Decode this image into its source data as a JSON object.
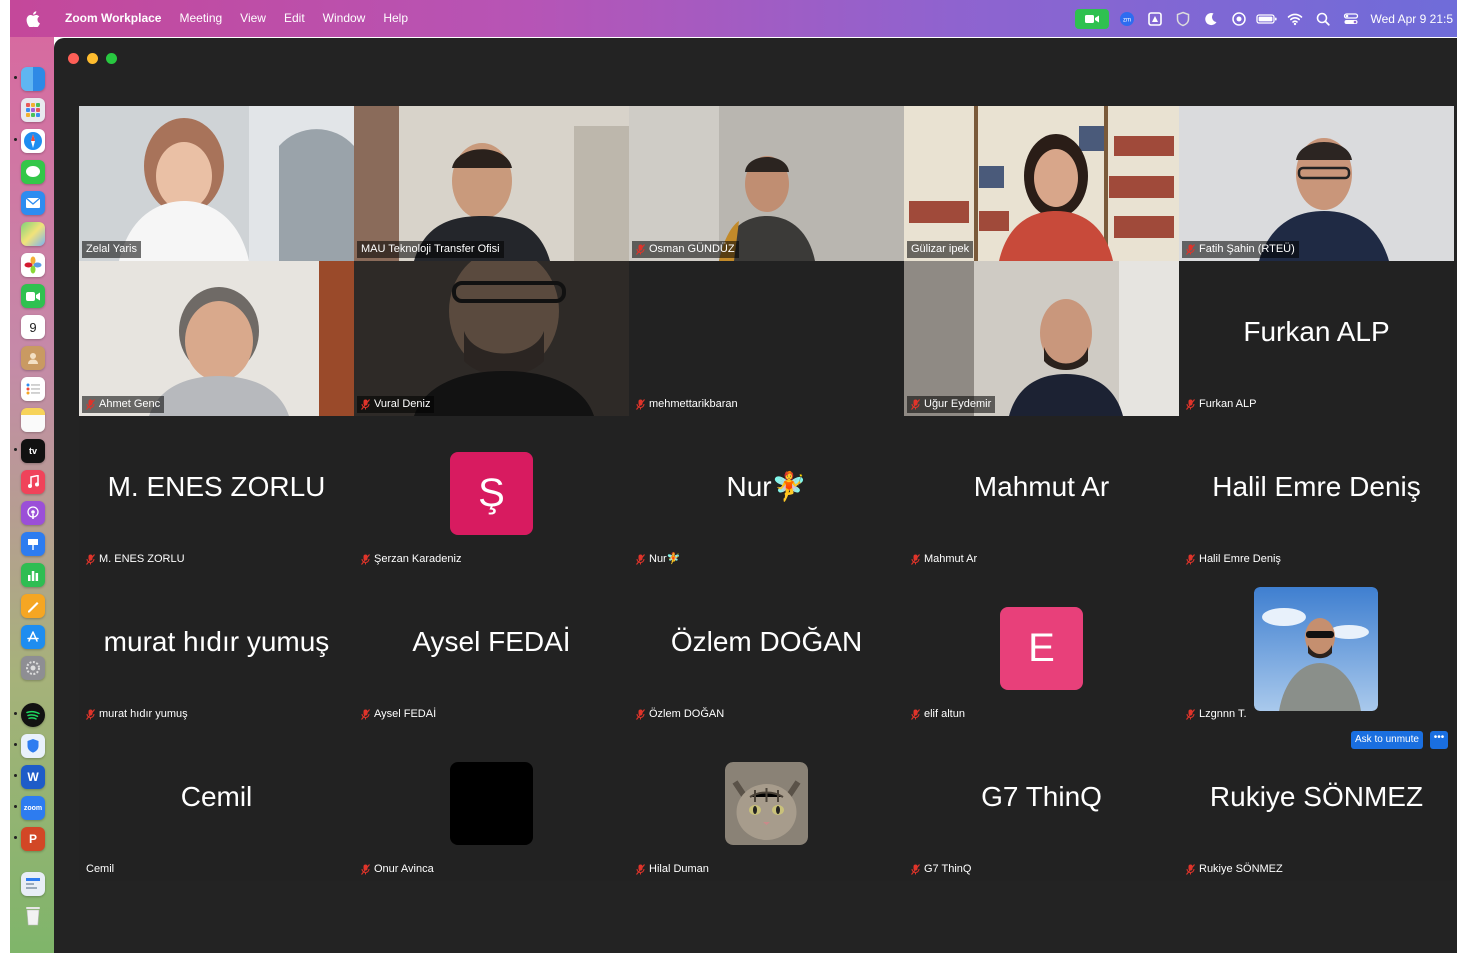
{
  "menubar": {
    "app_name": "Zoom Workplace",
    "menus": [
      "Meeting",
      "View",
      "Edit",
      "Window",
      "Help"
    ],
    "clock": "Wed Apr 9  21:5",
    "status_icons": [
      "zoom-camera-icon",
      "zoom-app-icon",
      "drive-icon",
      "shield-icon",
      "moon-icon",
      "record-icon",
      "battery-icon",
      "wifi-icon",
      "search-icon",
      "control-center-icon"
    ]
  },
  "dock": {
    "icons": [
      "finder",
      "launchpad",
      "safari",
      "messages",
      "mail",
      "maps",
      "photos",
      "facetime",
      "calendar",
      "contacts",
      "reminders",
      "notes",
      "tv",
      "music",
      "podcasts",
      "keynote",
      "numbers",
      "pages",
      "app-store",
      "system-settings",
      "spotify",
      "vpn",
      "word",
      "zoom",
      "powerpoint",
      "downloads",
      "trash"
    ],
    "calendar_day": "9",
    "tv_label": "tv",
    "zoom_label": "zoom"
  },
  "colors": {
    "window_bg": "#232323",
    "tile_bg": "#222222",
    "active_speaker": "#2fbd4a",
    "avatar_pink": "#d81b60",
    "avatar_e": "#e8407a",
    "ask_unmute": "#1a6fe0",
    "mic_muted": "#e0342a"
  },
  "participants": [
    {
      "name": "Zelal Yaris",
      "type": "video",
      "muted": false
    },
    {
      "name": "MAU Teknoloji Transfer Ofisi",
      "type": "video",
      "muted": false
    },
    {
      "name": "Osman GÜNDÜZ",
      "type": "video",
      "muted": true
    },
    {
      "name": "Gülizar ipek",
      "type": "video",
      "muted": false,
      "active": true
    },
    {
      "name": "Fatih Şahin (RTEÜ)",
      "type": "video",
      "muted": true
    },
    {
      "name": "Ahmet Genc",
      "type": "video",
      "muted": true
    },
    {
      "name": "Vural Deniz",
      "type": "video",
      "muted": true
    },
    {
      "name": "mehmettarikbaran",
      "type": "blank",
      "muted": true
    },
    {
      "name": "Uğur Eydemir",
      "type": "video",
      "muted": true
    },
    {
      "name": "Furkan ALP",
      "display": "Furkan ALP",
      "type": "name",
      "muted": true
    },
    {
      "name": "M. ENES ZORLU",
      "display": "M. ENES ZORLU",
      "type": "name",
      "muted": true
    },
    {
      "name": "Şerzan Karadeniz",
      "avatar_letter": "Ş",
      "type": "avatar",
      "color": "#d81b60",
      "muted": true
    },
    {
      "name": "Nur🧚",
      "display": "Nur🧚",
      "type": "name",
      "muted": true
    },
    {
      "name": "Mahmut Ar",
      "display": "Mahmut Ar",
      "type": "name",
      "muted": true
    },
    {
      "name": "Halil Emre Deniş",
      "display": "Halil Emre Deniş",
      "type": "name",
      "muted": true
    },
    {
      "name": "murat hıdır yumuş",
      "display": "murat hıdır yumuş",
      "type": "name",
      "muted": true
    },
    {
      "name": "Aysel FEDAİ",
      "display": "Aysel FEDAİ",
      "type": "name",
      "muted": true
    },
    {
      "name": "Özlem DOĞAN",
      "display": "Özlem DOĞAN",
      "type": "name",
      "muted": true
    },
    {
      "name": "elif altun",
      "avatar_letter": "E",
      "type": "avatar",
      "color": "#e8407a",
      "muted": true
    },
    {
      "name": "Lzgnnn T.",
      "type": "photo",
      "muted": true
    },
    {
      "name": "Cemil",
      "display": "Cemil",
      "type": "name",
      "muted": false
    },
    {
      "name": "Onur Avinca",
      "type": "avatar-black",
      "color": "#000000",
      "muted": true
    },
    {
      "name": "Hilal Duman",
      "type": "cat-photo",
      "muted": true
    },
    {
      "name": "G7 ThinQ",
      "display": "G7 ThinQ",
      "type": "name",
      "muted": true
    },
    {
      "name": "Rukiye SÖNMEZ",
      "display": "Rukiye SÖNMEZ",
      "type": "name",
      "muted": true
    }
  ],
  "ask_unmute": {
    "label": "Ask to unmute",
    "more": "•••"
  }
}
